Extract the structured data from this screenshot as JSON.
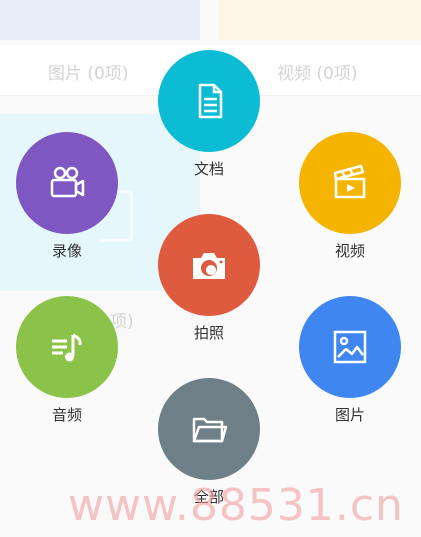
{
  "background": {
    "labels": [
      "图片 (0项)",
      "视频 (0项)",
      "项)"
    ]
  },
  "menu": {
    "items": [
      {
        "label": "文档",
        "color": "#0bbcd4",
        "icon": "document-icon"
      },
      {
        "label": "录像",
        "color": "#7e57c2",
        "icon": "video-camera-icon"
      },
      {
        "label": "视频",
        "color": "#f5b400",
        "icon": "clapperboard-icon"
      },
      {
        "label": "拍照",
        "color": "#df5b40",
        "icon": "camera-icon"
      },
      {
        "label": "音频",
        "color": "#8bc34a",
        "icon": "music-icon"
      },
      {
        "label": "图片",
        "color": "#3f86f0",
        "icon": "image-icon"
      },
      {
        "label": "全部",
        "color": "#6f7f87",
        "icon": "folder-icon"
      }
    ]
  },
  "watermark": "www.88531.cn"
}
